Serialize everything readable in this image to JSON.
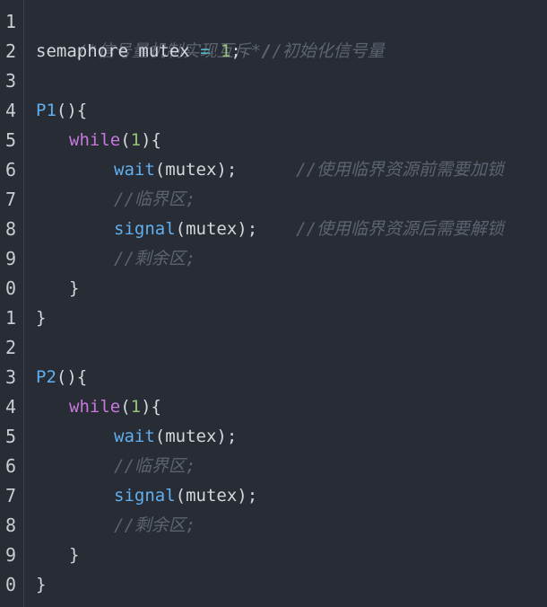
{
  "line_numbers": [
    "1",
    "2",
    "3",
    "4",
    "5",
    "6",
    "7",
    "8",
    "9",
    "0",
    "1",
    "2",
    "3",
    "4",
    "5",
    "6",
    "7",
    "8",
    "9",
    "0"
  ],
  "code": {
    "l1": {
      "comment": "/*信号量机制实现互斥*/"
    },
    "l2": {
      "type": "semaphore",
      "var": "mutex",
      "eq": "=",
      "num": "1",
      "semi": ";",
      "comment": "//初始化信号量"
    },
    "l4": {
      "fn": "P1",
      "rest": "(){"
    },
    "l5": {
      "kw": "while",
      "open": "(",
      "num": "1",
      "close": "){"
    },
    "l6": {
      "fn": "wait",
      "rest": "(mutex);",
      "comment": "//使用临界资源前需要加锁"
    },
    "l7": {
      "comment": "//临界区;"
    },
    "l8": {
      "fn": "signal",
      "rest": "(mutex);",
      "comment": "//使用临界资源后需要解锁"
    },
    "l9": {
      "comment": "//剩余区;"
    },
    "l10": {
      "text": "}"
    },
    "l11": {
      "text": "}"
    },
    "l13": {
      "fn": "P2",
      "rest": "(){"
    },
    "l14": {
      "kw": "while",
      "open": "(",
      "num": "1",
      "close": "){"
    },
    "l15": {
      "fn": "wait",
      "rest": "(mutex);"
    },
    "l16": {
      "comment": "//临界区;"
    },
    "l17": {
      "fn": "signal",
      "rest": "(mutex);"
    },
    "l18": {
      "comment": "//剩余区;"
    },
    "l19": {
      "text": "}"
    },
    "l20": {
      "text": "}"
    }
  }
}
